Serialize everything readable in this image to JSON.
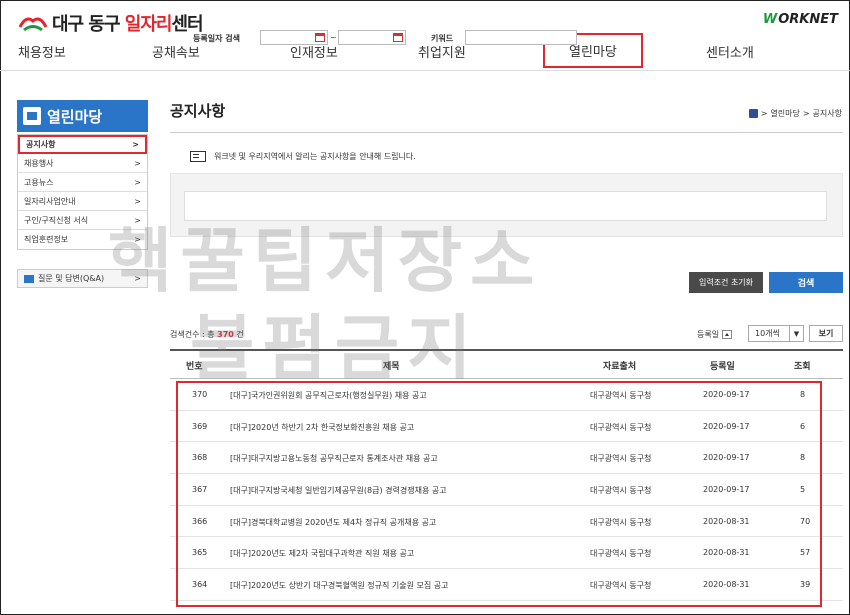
{
  "header": {
    "logo_prefix": "대구 동구",
    "logo_highlight": "일자리",
    "logo_suffix": "센터",
    "partner_mark": "W",
    "partner_text": "ORKNET"
  },
  "gnb": [
    "채용정보",
    "공채속보",
    "인재정보",
    "취업지원",
    "열린마당",
    "센터소개"
  ],
  "sidebar": {
    "title": "열린마당",
    "items": [
      {
        "label": "공지사항"
      },
      {
        "label": "채용행사"
      },
      {
        "label": "고용뉴스"
      },
      {
        "label": "일자리사업안내"
      },
      {
        "label": "구인/구직신청 서식"
      },
      {
        "label": "직업훈련정보"
      }
    ],
    "qna": "질문 및 답변(Q&A)",
    "chevron": ">"
  },
  "page": {
    "title": "공지사항",
    "breadcrumb": [
      "열린마당",
      "공지사항"
    ],
    "notice_text": "워크넷 및 우리지역에서 알리는 공지사항을 안내해 드립니다."
  },
  "search": {
    "date_label": "등록일자 검색",
    "tilde": "~",
    "keyword_label": "키워드",
    "reset_label": "입력조건 초기화",
    "search_label": "검색"
  },
  "list": {
    "count_prefix": "검색건수 : 총",
    "count_value": "370",
    "count_suffix": "건",
    "sort_label": "등록일",
    "page_size": "10개씩",
    "view_label": "보기",
    "columns": [
      "번호",
      "제목",
      "자료출처",
      "등록일",
      "조회"
    ],
    "rows": [
      {
        "no": "370",
        "title": "[대구]국가인권위원회 공무직근로자(행정실무원) 채용 공고",
        "source": "대구광역시 동구청",
        "date": "2020-09-17",
        "views": "8"
      },
      {
        "no": "369",
        "title": "[대구]2020년 하반기 2차 한국정보화진흥원 채용 공고",
        "source": "대구광역시 동구청",
        "date": "2020-09-17",
        "views": "6"
      },
      {
        "no": "368",
        "title": "[대구]대구지방고용노동청 공무직근로자 통계조사관 채용 공고",
        "source": "대구광역시 동구청",
        "date": "2020-09-17",
        "views": "8"
      },
      {
        "no": "367",
        "title": "[대구]대구지방국세청 일반임기제공무원(8급) 경력경쟁채용 공고",
        "source": "대구광역시 동구청",
        "date": "2020-09-17",
        "views": "5"
      },
      {
        "no": "366",
        "title": "[대구]경북대학교병원 2020년도 제4차 정규직 공개채용 공고",
        "source": "대구광역시 동구청",
        "date": "2020-08-31",
        "views": "70"
      },
      {
        "no": "365",
        "title": "[대구]2020년도 제2차 국립대구과학관 직원 채용 공고",
        "source": "대구광역시 동구청",
        "date": "2020-08-31",
        "views": "57"
      },
      {
        "no": "364",
        "title": "[대구]2020년도 상반기 대구경북혈액원 정규직 기술원 모집 공고",
        "source": "대구광역시 동구청",
        "date": "2020-08-31",
        "views": "39"
      }
    ]
  },
  "watermark": {
    "line1": "핵꿀팁저장소",
    "line2": "불펌금지"
  },
  "colors": {
    "accent_blue": "#2a75c7",
    "highlight_red": "#e0282e"
  }
}
